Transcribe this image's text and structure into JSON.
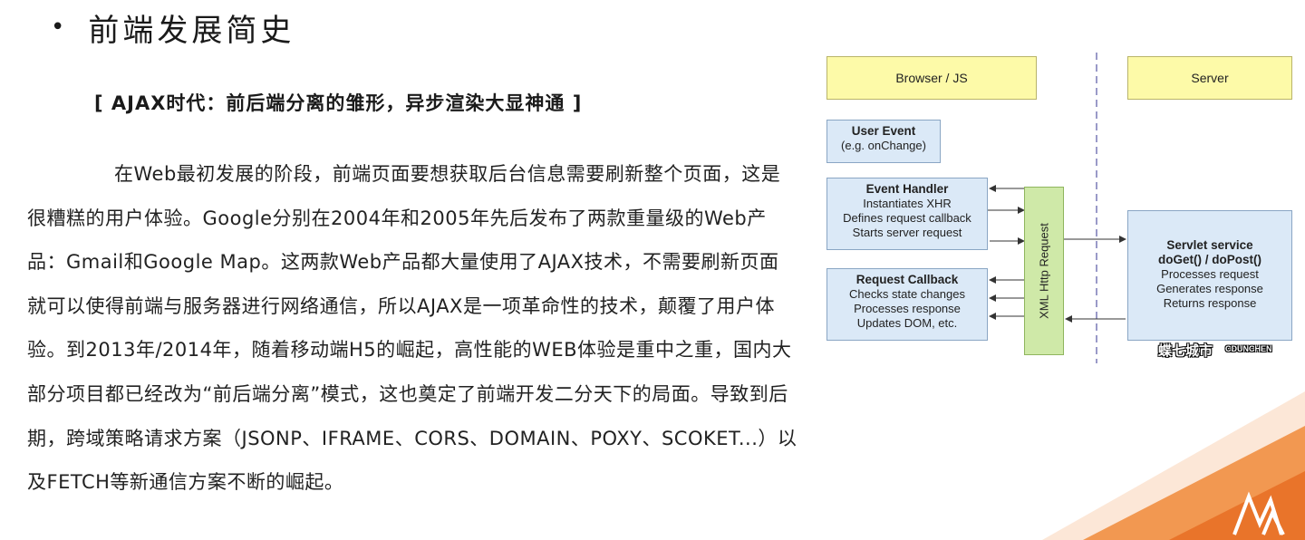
{
  "slide": {
    "bullet": "•",
    "title": "前端发展简史"
  },
  "section": {
    "heading": "[ AJAX时代：前后端分离的雏形，异步渲染大显神通 ]"
  },
  "body": {
    "paragraph": "在Web最初发展的阶段，前端页面要想获取后台信息需要刷新整个页面，这是很糟糕的用户体验。Google分别在2004年和2005年先后发布了两款重量级的Web产品：Gmail和Google Map。这两款Web产品都大量使用了AJAX技术，不需要刷新页面就可以使得前端与服务器进行网络通信，所以AJAX是一项革命性的技术，颠覆了用户体验。到2013年/2014年，随着移动端H5的崛起，高性能的WEB体验是重中之重，国内大部分项目都已经改为“前后端分离”模式，这也奠定了前端开发二分天下的局面。导致到后期，跨域策略请求方案（JSONP、IFRAME、CORS、DOMAIN、POXY、SCOKET...）以及FETCH等新通信方案不断的崛起。"
  },
  "diagram": {
    "browser_lane": "Browser / JS",
    "server_lane": "Server",
    "user_event": {
      "title": "User Event",
      "lines": [
        "(e.g. onChange)"
      ]
    },
    "event_handler": {
      "title": "Event Handler",
      "lines": [
        "Instantiates XHR",
        "Defines request callback",
        "Starts server request"
      ]
    },
    "request_callback": {
      "title": "Request Callback",
      "lines": [
        "Checks state changes",
        "Processes response",
        "Updates DOM, etc."
      ]
    },
    "xhr": "XML Http Request",
    "servlet": {
      "title": "Servlet service",
      "subtitle": "doGet() / doPost()",
      "lines": [
        "Processes request",
        "Generates response",
        "Returns response"
      ]
    },
    "watermark_left": "蝶七城市",
    "watermark_right": "CDUNCHEN"
  },
  "colors": {
    "lane_fill": "#fdfaa8",
    "box_fill": "#dbe9f7",
    "xhr_fill": "#cfe9a8",
    "accent_orange": "#f08a3a"
  }
}
